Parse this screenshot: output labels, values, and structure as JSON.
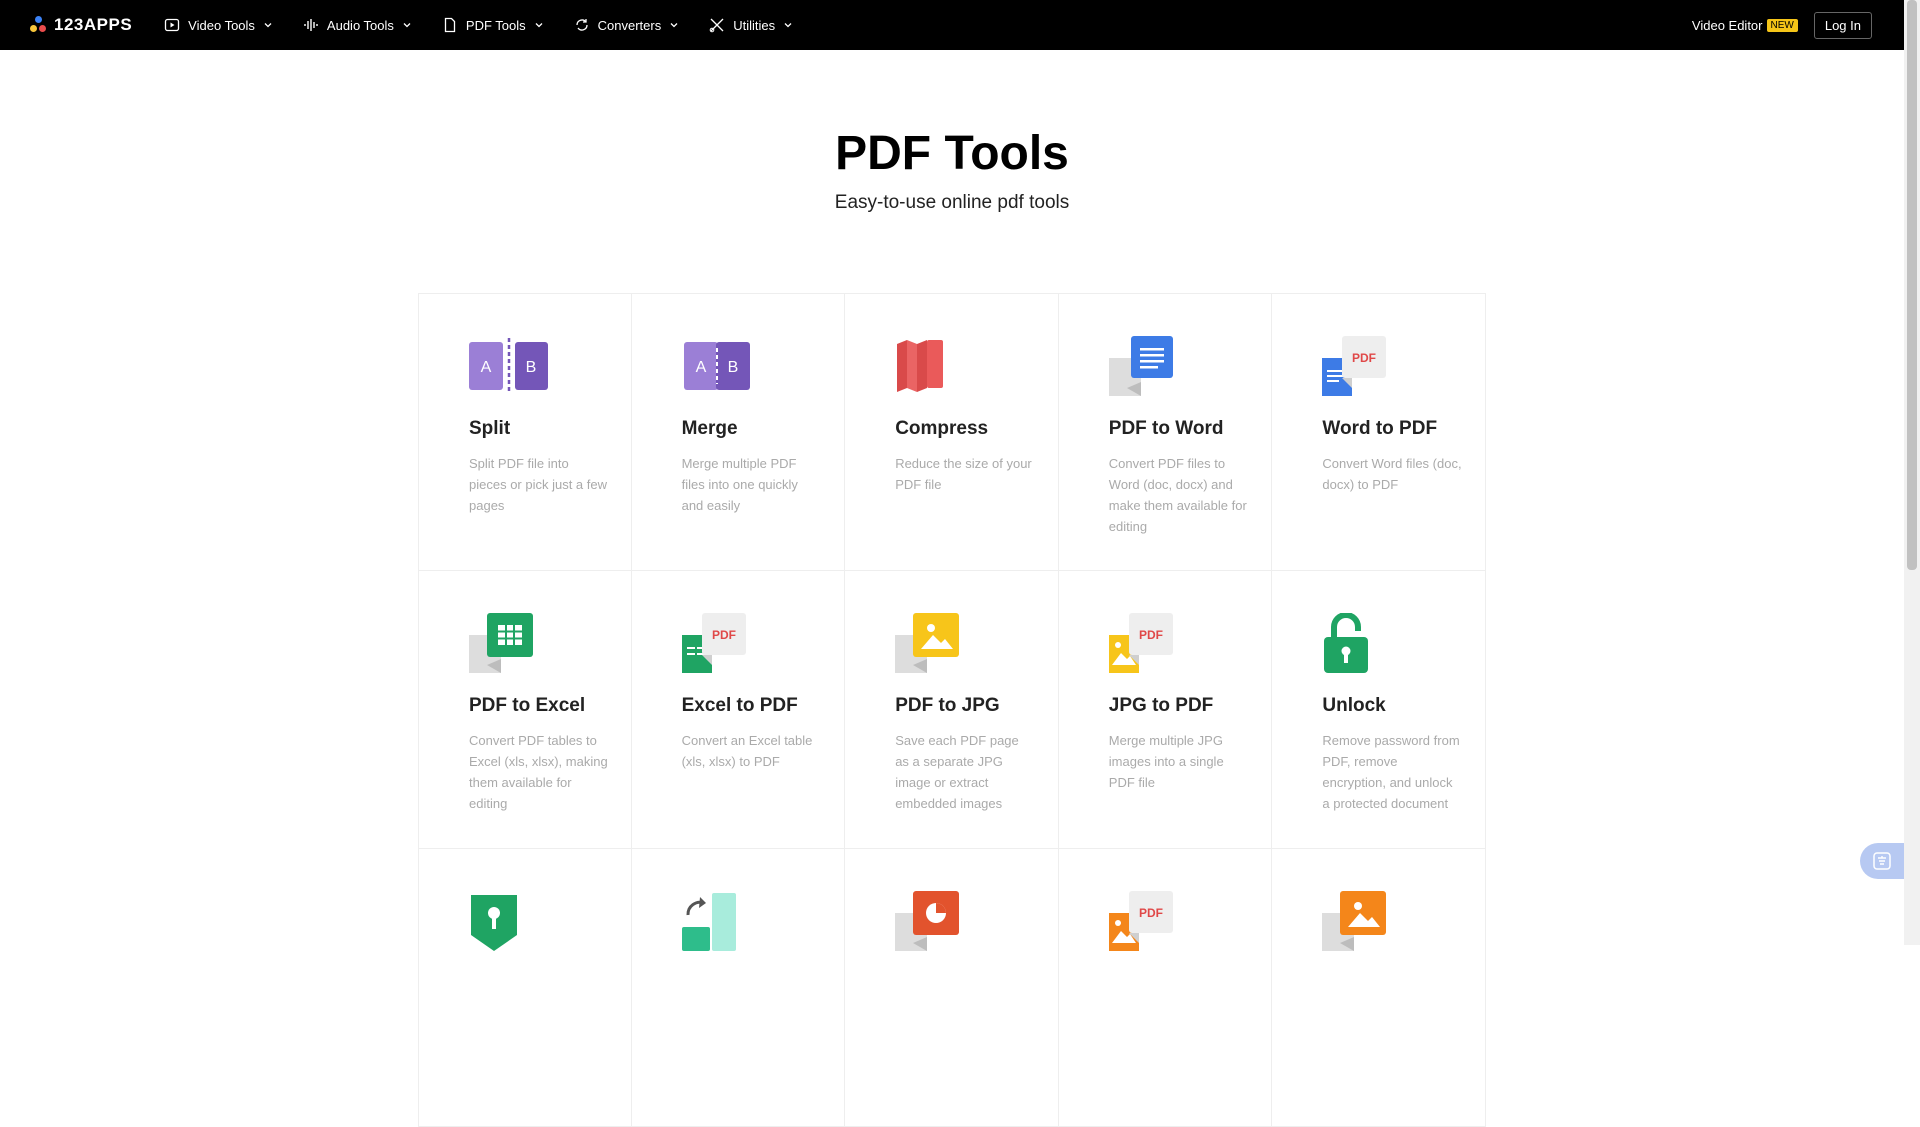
{
  "nav": {
    "logo": "123APPS",
    "menu": [
      {
        "label": "Video Tools",
        "icon": "play-icon"
      },
      {
        "label": "Audio Tools",
        "icon": "waveform-icon"
      },
      {
        "label": "PDF Tools",
        "icon": "document-icon"
      },
      {
        "label": "Converters",
        "icon": "convert-icon"
      },
      {
        "label": "Utilities",
        "icon": "scissors-icon"
      }
    ],
    "video_editor": "Video Editor",
    "new_badge": "NEW",
    "login": "Log In"
  },
  "hero": {
    "title": "PDF Tools",
    "subtitle": "Easy-to-use online pdf tools"
  },
  "tools": [
    {
      "title": "Split",
      "desc": "Split PDF file into pieces or pick just a few pages",
      "icon": "split-icon"
    },
    {
      "title": "Merge",
      "desc": "Merge multiple PDF files into one quickly and easily",
      "icon": "merge-icon"
    },
    {
      "title": "Compress",
      "desc": "Reduce the size of your PDF file",
      "icon": "compress-icon"
    },
    {
      "title": "PDF to Word",
      "desc": "Convert PDF files to Word (doc, docx) and make them available for editing",
      "icon": "pdf-to-word-icon"
    },
    {
      "title": "Word to PDF",
      "desc": "Convert Word files (doc, docx) to PDF",
      "icon": "word-to-pdf-icon"
    },
    {
      "title": "PDF to Excel",
      "desc": "Convert PDF tables to Excel (xls, xlsx), making them available for editing",
      "icon": "pdf-to-excel-icon"
    },
    {
      "title": "Excel to PDF",
      "desc": "Convert an Excel table (xls, xlsx) to PDF",
      "icon": "excel-to-pdf-icon"
    },
    {
      "title": "PDF to JPG",
      "desc": "Save each PDF page as a separate JPG image or extract embedded images",
      "icon": "pdf-to-jpg-icon"
    },
    {
      "title": "JPG to PDF",
      "desc": "Merge multiple JPG images into a single PDF file",
      "icon": "jpg-to-pdf-icon"
    },
    {
      "title": "Unlock",
      "desc": "Remove password from PDF, remove encryption, and unlock a protected document",
      "icon": "unlock-icon"
    },
    {
      "title": "",
      "desc": "",
      "icon": "protect-icon"
    },
    {
      "title": "",
      "desc": "",
      "icon": "rotate-icon"
    },
    {
      "title": "",
      "desc": "",
      "icon": "pdf-to-ppt-icon"
    },
    {
      "title": "",
      "desc": "",
      "icon": "image-to-pdf-icon"
    },
    {
      "title": "",
      "desc": "",
      "icon": "image-icon"
    }
  ],
  "pdf_label": "PDF",
  "split_labels": [
    "A",
    "B"
  ]
}
